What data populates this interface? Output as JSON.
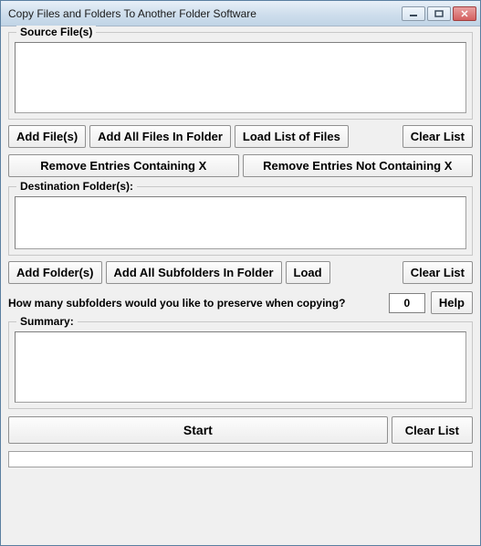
{
  "window": {
    "title": "Copy Files and Folders To Another Folder Software"
  },
  "groups": {
    "source_label": "Source File(s)",
    "dest_label": "Destination Folder(s):",
    "summary_label": "Summary:"
  },
  "buttons": {
    "add_files": "Add File(s)",
    "add_all_files": "Add All Files In Folder",
    "load_list_files": "Load List of Files",
    "clear_list_1": "Clear List",
    "remove_containing": "Remove Entries Containing X",
    "remove_not_containing": "Remove Entries Not Containing X",
    "add_folders": "Add Folder(s)",
    "add_all_subfolders": "Add All Subfolders In Folder",
    "load": "Load",
    "clear_list_2": "Clear List",
    "help": "Help",
    "start": "Start",
    "clear_list_3": "Clear List"
  },
  "prompt": {
    "subfolders_label": "How many subfolders would you like to preserve when copying?",
    "subfolders_value": "0"
  }
}
